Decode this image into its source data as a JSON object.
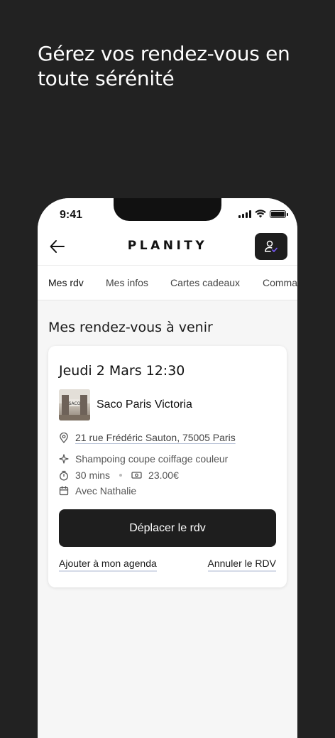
{
  "headline": "Gérez vos rendez-vous en toute sérénité",
  "status_bar": {
    "time": "9:41"
  },
  "header": {
    "brand": "PLANITY"
  },
  "tabs": [
    {
      "label": "Mes rdv",
      "active": true
    },
    {
      "label": "Mes infos",
      "active": false
    },
    {
      "label": "Cartes cadeaux",
      "active": false
    },
    {
      "label": "Comma",
      "active": false
    }
  ],
  "section_title": "Mes rendez-vous à venir",
  "appointment": {
    "date": "Jeudi 2 Mars 12:30",
    "salon_name": "Saco Paris Victoria",
    "address": "21 rue Frédéric Sauton, 75005 Paris",
    "service": "Shampoing coupe coiffage couleur",
    "duration": "30 mins",
    "price": "23.00€",
    "staff": "Avec Nathalie",
    "primary_action": "Déplacer le rdv",
    "add_calendar": "Ajouter à mon agenda",
    "cancel": "Annuler le RDV"
  },
  "icons": [
    "back-arrow-icon",
    "profile-check-icon",
    "location-pin-icon",
    "sparkle-icon",
    "timer-icon",
    "cash-icon",
    "calendar-icon",
    "signal-icon",
    "wifi-icon",
    "battery-icon"
  ],
  "colors": {
    "background": "#222222",
    "dark_button": "#1e1e1e",
    "screen": "#f6f6f6",
    "accent_check": "#7b5cff"
  }
}
